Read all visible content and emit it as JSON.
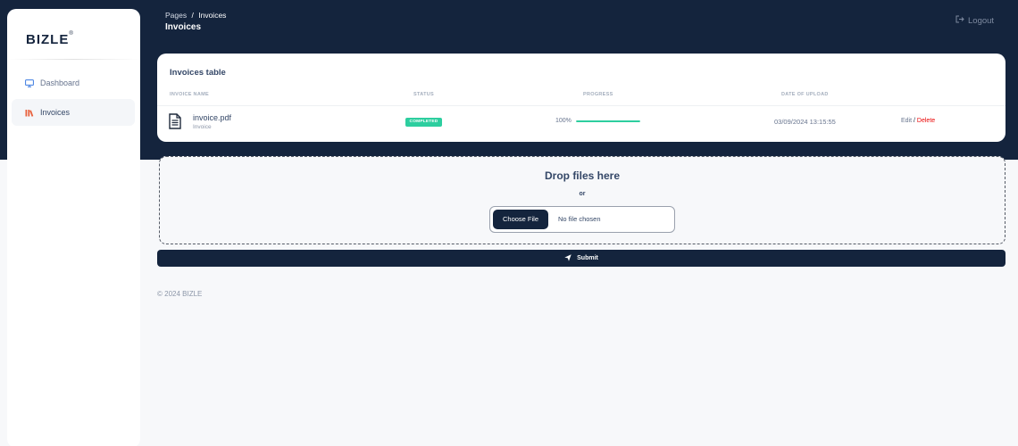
{
  "sidebar": {
    "brand": "BIZLE",
    "brand_mark": "®",
    "items": [
      {
        "label": "Dashboard",
        "icon": "monitor-icon",
        "active": false
      },
      {
        "label": "Invoices",
        "icon": "bars-icon",
        "active": true
      }
    ]
  },
  "header": {
    "breadcrumb": {
      "root": "Pages",
      "separator": "/",
      "current": "Invoices"
    },
    "title": "Invoices",
    "logout_label": "Logout"
  },
  "invoices_table": {
    "title": "Invoices table",
    "columns": [
      "INVOICE NAME",
      "STATUS",
      "PROGRESS",
      "DATE OF UPLOAD"
    ],
    "rows": [
      {
        "name": "invoice.pdf",
        "type": "Invoice",
        "status": "COMPLETED",
        "progress_label": "100%",
        "progress": 1.0,
        "date": "03/09/2024 13:15:55",
        "edit_label": "Edit",
        "separator": "/",
        "delete_label": "Delete"
      }
    ]
  },
  "upload": {
    "drop_title": "Drop files here",
    "or_label": "or",
    "choose_label": "Choose File",
    "no_file_label": "No file chosen",
    "submit_label": "Submit"
  },
  "footer": {
    "text": "© 2024 BIZLE"
  },
  "colors": {
    "navy": "#14243d",
    "success": "#2dce9f",
    "danger": "#ea0606",
    "accent_orange": "#e8603c"
  }
}
